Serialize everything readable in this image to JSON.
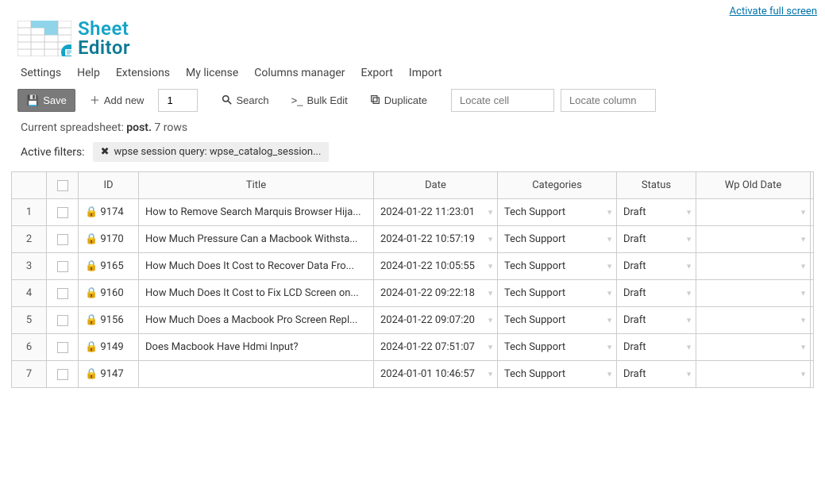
{
  "topLink": "Activate full screen",
  "logo": {
    "line1": "Sheet",
    "line2": "Editor"
  },
  "menu": {
    "settings": "Settings",
    "help": "Help",
    "extensions": "Extensions",
    "license": "My license",
    "columns": "Columns manager",
    "export": "Export",
    "import": "Import"
  },
  "toolbar": {
    "save": "Save",
    "addNew": "Add new",
    "addNewCount": "1",
    "search": "Search",
    "bulkEdit": "Bulk Edit",
    "duplicate": "Duplicate",
    "locateCellPlaceholder": "Locate cell",
    "locateColumnPlaceholder": "Locate column"
  },
  "infoPrefix": "Current spreadsheet: ",
  "infoName": "post.",
  "infoRows": " 7 rows",
  "filtersLabel": "Active filters:",
  "filterChip": "wpse session query: wpse_catalog_session...",
  "headers": {
    "id": "ID",
    "title": "Title",
    "date": "Date",
    "categories": "Categories",
    "status": "Status",
    "oldDate": "Wp Old Date"
  },
  "rows": [
    {
      "n": "1",
      "id": "9174",
      "title": "How to Remove Search Marquis Browser Hija...",
      "date": "2024-01-22 11:23:01",
      "cat": "Tech Support",
      "status": "Draft",
      "old": ""
    },
    {
      "n": "2",
      "id": "9170",
      "title": "How Much Pressure Can a Macbook Withsta...",
      "date": "2024-01-22 10:57:19",
      "cat": "Tech Support",
      "status": "Draft",
      "old": ""
    },
    {
      "n": "3",
      "id": "9165",
      "title": "How Much Does It Cost to Recover Data Fro...",
      "date": "2024-01-22 10:05:55",
      "cat": "Tech Support",
      "status": "Draft",
      "old": ""
    },
    {
      "n": "4",
      "id": "9160",
      "title": "How Much Does It Cost to Fix LCD Screen on...",
      "date": "2024-01-22 09:22:18",
      "cat": "Tech Support",
      "status": "Draft",
      "old": ""
    },
    {
      "n": "5",
      "id": "9156",
      "title": "How Much Does a Macbook Pro Screen Repl...",
      "date": "2024-01-22 09:07:20",
      "cat": "Tech Support",
      "status": "Draft",
      "old": ""
    },
    {
      "n": "6",
      "id": "9149",
      "title": "Does Macbook Have Hdmi Input?",
      "date": "2024-01-22 07:51:07",
      "cat": "Tech Support",
      "status": "Draft",
      "old": ""
    },
    {
      "n": "7",
      "id": "9147",
      "title": "",
      "date": "2024-01-01 10:46:57",
      "cat": "Tech Support",
      "status": "Draft",
      "old": ""
    }
  ]
}
